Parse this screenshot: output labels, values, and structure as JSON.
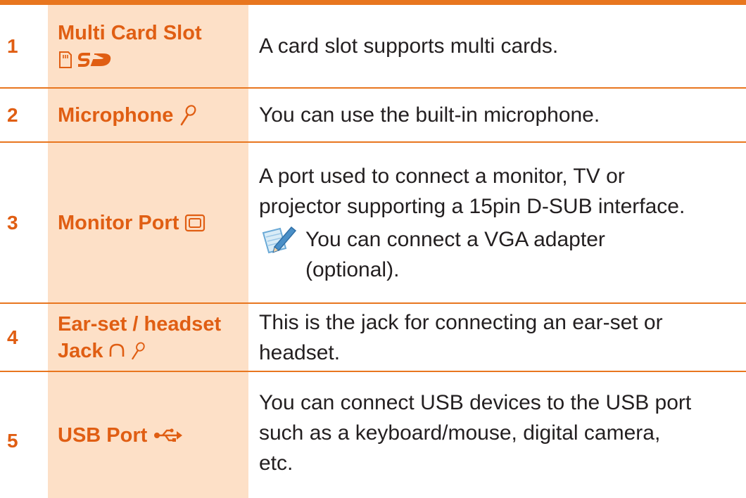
{
  "colors": {
    "accent": "#e8761f",
    "title_text": "#e05e13",
    "name_column_bg": "#fde0c7",
    "body_text": "#231f20"
  },
  "rows": [
    {
      "number": "1",
      "name": "Multi Card Slot",
      "icons": [
        "sd-card-icon",
        "sd-logo-icon"
      ],
      "description": [
        "A card slot supports multi cards."
      ]
    },
    {
      "number": "2",
      "name": "Microphone",
      "icons": [
        "microphone-icon"
      ],
      "description": [
        "You can use the built-in microphone."
      ]
    },
    {
      "number": "3",
      "name": "Monitor Port",
      "icons": [
        "monitor-icon"
      ],
      "description": [
        "A port used to connect a monitor, TV or",
        "projector supporting a 15pin D-SUB interface."
      ],
      "note": {
        "icon": "memo-pencil-icon",
        "lines": [
          "You can connect a VGA adapter",
          "(optional)."
        ]
      }
    },
    {
      "number": "4",
      "name_lines": [
        "Ear-set / headset",
        "Jack"
      ],
      "icons": [
        "headphone-icon",
        "microphone-icon"
      ],
      "description": [
        "This is the jack for connecting an ear-set or",
        "headset."
      ]
    },
    {
      "number": "5",
      "name": "USB Port",
      "icons": [
        "usb-icon"
      ],
      "description": [
        "You can connect USB devices to the USB port",
        "such as a keyboard/mouse, digital camera,",
        "etc."
      ]
    }
  ]
}
